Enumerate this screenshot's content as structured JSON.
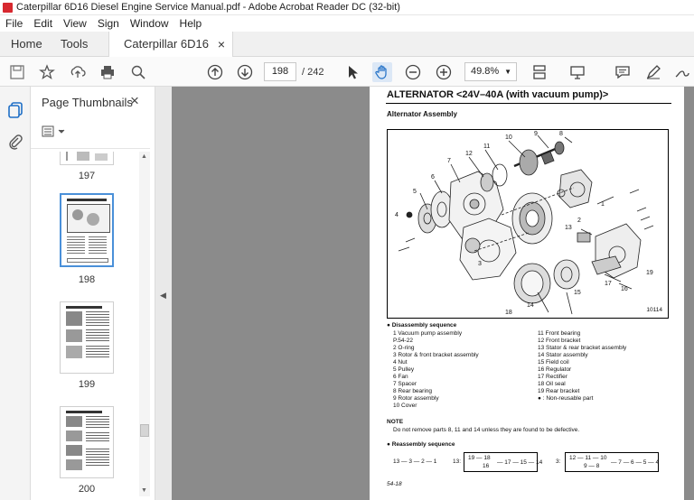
{
  "window": {
    "title": "Caterpillar 6D16 Diesel Engine Service Manual.pdf - Adobe Acrobat Reader DC (32-bit)"
  },
  "menu": [
    "File",
    "Edit",
    "View",
    "Sign",
    "Window",
    "Help"
  ],
  "tabs": {
    "home": "Home",
    "tools": "Tools",
    "doc": "Caterpillar 6D16 Di...",
    "close": "×"
  },
  "toolbar": {
    "page_current": "198",
    "page_total": "/ 242",
    "zoom": "49.8%"
  },
  "thumbnails": {
    "title": "Page Thumbnails",
    "close": "×",
    "pages": [
      "197",
      "198",
      "199",
      "200"
    ]
  },
  "doc": {
    "title": "ALTERNATOR <24V–40A (with vacuum pump)>",
    "subtitle": "Alternator Assembly",
    "figure_no": "10114",
    "disassembly_heading": "Disassembly  sequence",
    "left_list": [
      "1   Vacuum pump assembly",
      "      P.54-22",
      "2   O-ring",
      "3   Rotor & front bracket assembly",
      "4   Nut",
      "5   Pulley",
      "6   Fan",
      "7   Spacer",
      "8   Rear bearing",
      "9   Rotor assembly",
      "10  Cover"
    ],
    "right_list": [
      "11  Front bearing",
      "12  Front bracket",
      "13  Stator & rear bracket assembly",
      "14  Stator assembly",
      "15  Field coil",
      "16  Regulator",
      "17  Rectifier",
      "18  Oil seal",
      "19  Rear bracket",
      "",
      "● : Non-reusable part"
    ],
    "note_heading": "NOTE",
    "note_text": "Do not remove parts 8, 11 and 14 unless they are found to be defective.",
    "reassembly_heading": "Reassembly sequence",
    "seq1": "13 — 3 — 2 — 1",
    "seq2_label": "13:",
    "seq2_a": "19 — 18",
    "seq2_b": "16",
    "seq2_c": "— 17 — 15 — 14",
    "seq3_label": "3:",
    "seq3_a": "12 — 11 — 10",
    "seq3_b": "9 — 8",
    "seq3_c": "— 7 — 6 — 5 — 4",
    "page_footer": "54-18"
  }
}
